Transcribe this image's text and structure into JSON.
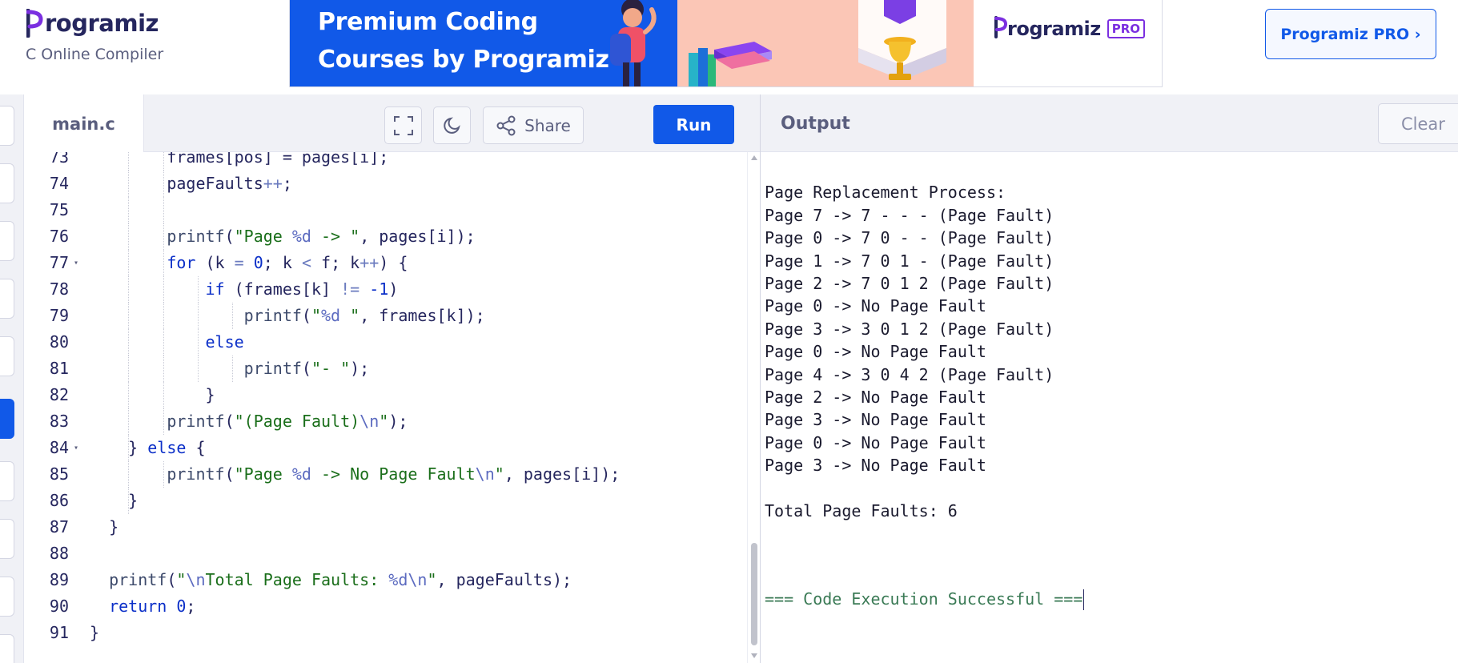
{
  "header": {
    "brand": "rogramiz",
    "subtitle": "C Online Compiler",
    "banner": {
      "line1": "Premium Coding",
      "line2": "Courses by Programiz",
      "pro_word": "rogramiz",
      "pro_badge": "PRO"
    },
    "pro_button": "Programiz PRO ›"
  },
  "colors": {
    "accent": "#1159e8",
    "brand_dark": "#25265e",
    "purple": "#7b2fe0"
  },
  "editor": {
    "file_tab": "main.c",
    "toolbar": {
      "fullscreen_icon": "fullscreen-icon",
      "theme_icon": "moon-icon",
      "share_icon": "share-icon",
      "share_label": "Share",
      "run_label": "Run"
    },
    "lines": [
      {
        "n": "73",
        "fold": false,
        "guides": 2,
        "tokens": [
          [
            "",
            "        frames[pos] = pages[i];"
          ]
        ]
      },
      {
        "n": "74",
        "fold": false,
        "guides": 2,
        "tokens": [
          [
            "",
            "        pageFaults"
          ],
          [
            "op",
            "++"
          ],
          [
            "",
            ";"
          ]
        ]
      },
      {
        "n": "75",
        "fold": false,
        "guides": 2,
        "tokens": [
          [
            "",
            ""
          ]
        ]
      },
      {
        "n": "76",
        "fold": false,
        "guides": 2,
        "tokens": [
          [
            "fn",
            "        printf"
          ],
          [
            "",
            "("
          ],
          [
            "str",
            "\"Page "
          ],
          [
            "esc",
            "%d"
          ],
          [
            "str",
            " -> \""
          ],
          [
            "",
            ", pages[i]);"
          ]
        ]
      },
      {
        "n": "77",
        "fold": true,
        "guides": 2,
        "tokens": [
          [
            "kw",
            "        for"
          ],
          [
            "",
            " (k "
          ],
          [
            "op",
            "="
          ],
          [
            "",
            " "
          ],
          [
            "num",
            "0"
          ],
          [
            "",
            "; k "
          ],
          [
            "op",
            "<"
          ],
          [
            "",
            " f; k"
          ],
          [
            "op",
            "++"
          ],
          [
            "",
            ") {"
          ]
        ]
      },
      {
        "n": "78",
        "fold": false,
        "guides": 3,
        "tokens": [
          [
            "kw",
            "            if"
          ],
          [
            "",
            " (frames[k] "
          ],
          [
            "op",
            "!="
          ],
          [
            "",
            " "
          ],
          [
            "num",
            "-1"
          ],
          [
            "",
            ")"
          ]
        ]
      },
      {
        "n": "79",
        "fold": false,
        "guides": 4,
        "tokens": [
          [
            "fn",
            "                printf"
          ],
          [
            "",
            "("
          ],
          [
            "str",
            "\""
          ],
          [
            "esc",
            "%d"
          ],
          [
            "str",
            " \""
          ],
          [
            "",
            ", frames[k]);"
          ]
        ]
      },
      {
        "n": "80",
        "fold": false,
        "guides": 3,
        "tokens": [
          [
            "kw",
            "            else"
          ]
        ]
      },
      {
        "n": "81",
        "fold": false,
        "guides": 4,
        "tokens": [
          [
            "fn",
            "                printf"
          ],
          [
            "",
            "("
          ],
          [
            "str",
            "\"- \""
          ],
          [
            "",
            ");"
          ]
        ]
      },
      {
        "n": "82",
        "fold": false,
        "guides": 2,
        "tokens": [
          [
            "",
            "            }"
          ]
        ]
      },
      {
        "n": "83",
        "fold": false,
        "guides": 2,
        "tokens": [
          [
            "fn",
            "        printf"
          ],
          [
            "",
            "("
          ],
          [
            "str",
            "\"(Page Fault)"
          ],
          [
            "esc",
            "\\n"
          ],
          [
            "str",
            "\""
          ],
          [
            "",
            ");"
          ]
        ]
      },
      {
        "n": "84",
        "fold": true,
        "guides": 1,
        "tokens": [
          [
            "",
            "    } "
          ],
          [
            "kw",
            "else"
          ],
          [
            "",
            " {"
          ]
        ]
      },
      {
        "n": "85",
        "fold": false,
        "guides": 2,
        "tokens": [
          [
            "fn",
            "        printf"
          ],
          [
            "",
            "("
          ],
          [
            "str",
            "\"Page "
          ],
          [
            "esc",
            "%d"
          ],
          [
            "str",
            " -> No Page Fault"
          ],
          [
            "esc",
            "\\n"
          ],
          [
            "str",
            "\""
          ],
          [
            "",
            ", pages[i]);"
          ]
        ]
      },
      {
        "n": "86",
        "fold": false,
        "guides": 1,
        "tokens": [
          [
            "",
            "    }"
          ]
        ]
      },
      {
        "n": "87",
        "fold": false,
        "guides": 0,
        "tokens": [
          [
            "",
            "  }"
          ]
        ]
      },
      {
        "n": "88",
        "fold": false,
        "guides": 0,
        "tokens": [
          [
            "",
            ""
          ]
        ]
      },
      {
        "n": "89",
        "fold": false,
        "guides": 0,
        "tokens": [
          [
            "fn",
            "  printf"
          ],
          [
            "",
            "("
          ],
          [
            "str",
            "\""
          ],
          [
            "esc",
            "\\n"
          ],
          [
            "str",
            "Total Page Faults: "
          ],
          [
            "esc",
            "%d\\n"
          ],
          [
            "str",
            "\""
          ],
          [
            "",
            ", pageFaults);"
          ]
        ]
      },
      {
        "n": "90",
        "fold": false,
        "guides": 0,
        "tokens": [
          [
            "kw",
            "  return"
          ],
          [
            "",
            " "
          ],
          [
            "num",
            "0"
          ],
          [
            "",
            ";"
          ]
        ]
      },
      {
        "n": "91",
        "fold": false,
        "guides": 0,
        "tokens": [
          [
            "",
            "}"
          ]
        ]
      }
    ]
  },
  "output": {
    "title": "Output",
    "clear_label": "Clear",
    "lines": [
      "",
      "Page Replacement Process:",
      "Page 7 -> 7 - - - (Page Fault)",
      "Page 0 -> 7 0 - - (Page Fault)",
      "Page 1 -> 7 0 1 - (Page Fault)",
      "Page 2 -> 7 0 1 2 (Page Fault)",
      "Page 0 -> No Page Fault",
      "Page 3 -> 3 0 1 2 (Page Fault)",
      "Page 0 -> No Page Fault",
      "Page 4 -> 3 0 4 2 (Page Fault)",
      "Page 2 -> No Page Fault",
      "Page 3 -> No Page Fault",
      "Page 0 -> No Page Fault",
      "Page 3 -> No Page Fault",
      "",
      "Total Page Faults: 6",
      "",
      "",
      ""
    ],
    "success": "=== Code Execution Successful ==="
  }
}
